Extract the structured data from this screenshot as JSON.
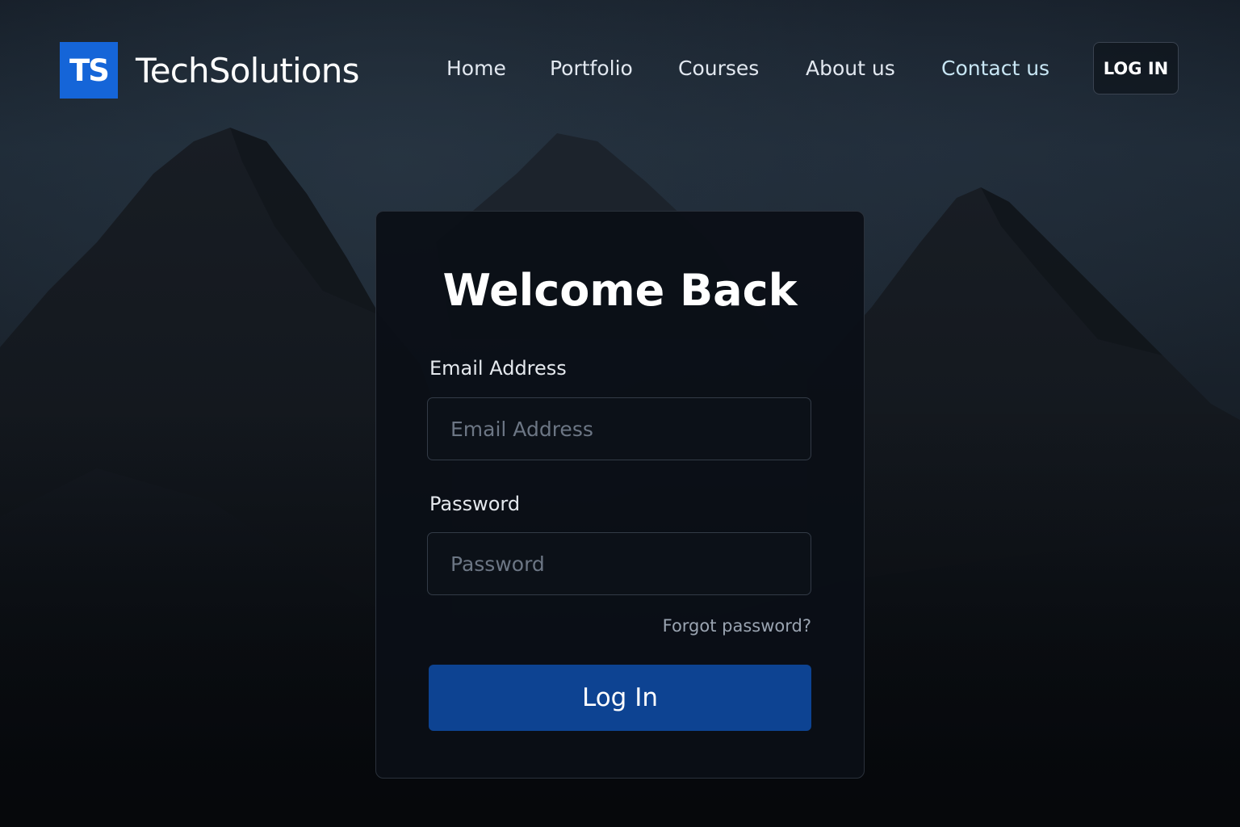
{
  "brand": {
    "logo_mark": "TS",
    "name": "TechSolutions",
    "accent_color": "#1565d8"
  },
  "nav": {
    "items": [
      {
        "label": "Home"
      },
      {
        "label": "Portfolio"
      },
      {
        "label": "Courses"
      },
      {
        "label": "About us"
      },
      {
        "label": "Contact us"
      }
    ],
    "login_label": "LOG IN"
  },
  "login_form": {
    "title": "Welcome Back",
    "email": {
      "label": "Email Address",
      "placeholder": "Email Address",
      "value": ""
    },
    "password": {
      "label": "Password",
      "placeholder": "Password",
      "value": ""
    },
    "forgot_label": "Forgot password?",
    "submit_label": "Log In",
    "submit_color": "#0d4392"
  },
  "background": {
    "image": "mountain-landscape",
    "color": "#0b0f15"
  }
}
